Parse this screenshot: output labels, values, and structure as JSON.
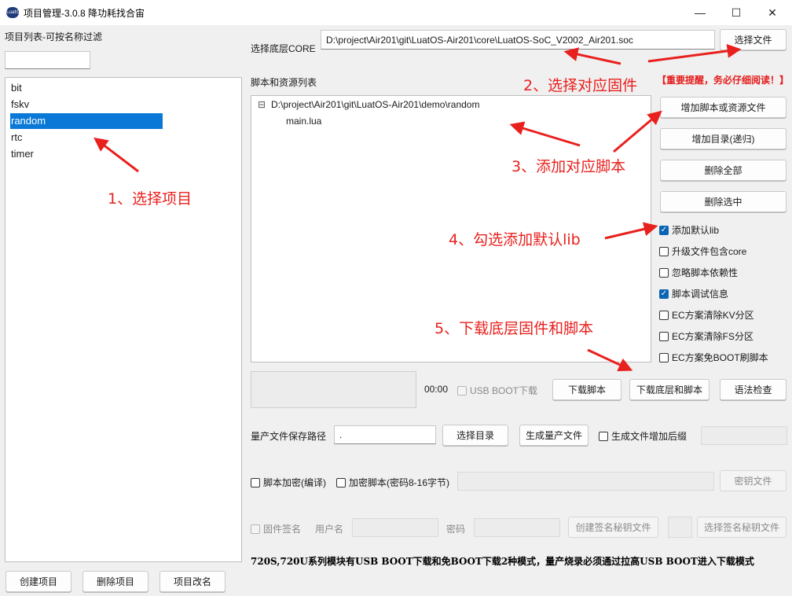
{
  "window": {
    "title": "项目管理-3.0.8 降功耗找合宙",
    "icon_text": "LuatOS",
    "minimize_glyph": "—",
    "maximize_glyph": "☐",
    "close_glyph": "✕"
  },
  "sidebar": {
    "heading": "项目列表-可按名称过滤",
    "filter_value": "",
    "items": [
      "bit",
      "fskv",
      "random",
      "rtc",
      "timer"
    ],
    "selected": "random",
    "create_label": "创建项目",
    "delete_label": "删除项目",
    "rename_label": "项目改名"
  },
  "core": {
    "label": "选择底层CORE",
    "path": "D:\\project\\Air201\\git\\LuatOS-Air201\\core\\LuatOS-SoC_V2002_Air201.soc",
    "choose_label": "选择文件",
    "warning": "【重要提醒，务必仔细阅读！】"
  },
  "scripts": {
    "label": "脚本和资源列表",
    "collapse_glyph": "⊟",
    "root": "D:\\project\\Air201\\git\\LuatOS-Air201\\demo\\random",
    "files": [
      "main.lua"
    ],
    "add_script_label": "增加脚本或资源文件",
    "add_dir_label": "增加目录(递归)",
    "delete_all_label": "删除全部",
    "delete_selected_label": "删除选中"
  },
  "options": [
    {
      "label": "添加默认lib",
      "checked": true
    },
    {
      "label": "升级文件包含core",
      "checked": false
    },
    {
      "label": "忽略脚本依赖性",
      "checked": false
    },
    {
      "label": "脚本调试信息",
      "checked": true
    },
    {
      "label": "EC方案清除KV分区",
      "checked": false
    },
    {
      "label": "EC方案清除FS分区",
      "checked": false
    },
    {
      "label": "EC方案免BOOT刷脚本",
      "checked": false
    }
  ],
  "download": {
    "timer": "00:00",
    "usb_boot_label": "USB BOOT下载",
    "download_script_label": "下载脚本",
    "download_all_label": "下载底层和脚本",
    "syntax_check_label": "语法检查"
  },
  "production": {
    "path_label": "量产文件保存路径",
    "path_value": ".",
    "choose_dir_label": "选择目录",
    "generate_label": "生成量产文件",
    "suffix_label": "生成文件增加后缀",
    "suffix_value": ""
  },
  "encryption": {
    "compile_label": "脚本加密(编译)",
    "encrypt_label": "加密脚本(密码8-16字节)",
    "key_value": "",
    "key_file_label": "密钥文件"
  },
  "signing": {
    "firmware_sign_label": "固件签名",
    "username_label": "用户名",
    "username_value": "",
    "password_label": "密码",
    "password_value": "",
    "create_key_label": "创建签名秘钥文件",
    "choose_key_label": "选择签名秘钥文件"
  },
  "footer_info": "720S,720U系列模块有USB BOOT下载和免BOOT下载2种模式，量产烧录必须通过拉高USB BOOT进入下载模式",
  "annotations": {
    "step1": "1、选择项目",
    "step2": "2、选择对应固件",
    "step3": "3、添加对应脚本",
    "step4": "4、勾选添加默认lib",
    "step5": "5、下载底层固件和脚本"
  },
  "colors": {
    "annotation": "#e8211e",
    "selection": "#0a78d7",
    "checkbox_checked": "#0a64b4",
    "background": "#f0f0f0"
  }
}
